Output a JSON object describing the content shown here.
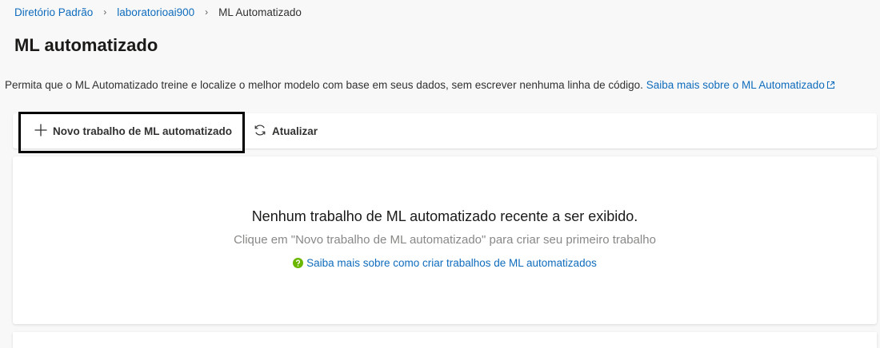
{
  "breadcrumb": {
    "items": [
      "Diretório Padrão",
      "laboratorioai900"
    ],
    "current": "ML Automatizado"
  },
  "page": {
    "title": "ML automatizado",
    "description": "Permita que o ML Automatizado treine e localize o melhor modelo com base em seus dados, sem escrever nenhuma linha de código.",
    "learn_more_link": "Saiba mais sobre o ML Automatizado"
  },
  "toolbar": {
    "new_job_label": "Novo trabalho de ML automatizado",
    "refresh_label": "Atualizar"
  },
  "empty_state": {
    "title": "Nenhum trabalho de ML automatizado recente a ser exibido.",
    "subtitle": "Clique em \"Novo trabalho de ML automatizado\" para criar seu primeiro trabalho",
    "help_link": "Saiba mais sobre como criar trabalhos de ML automatizados"
  },
  "icons": {
    "external_link": "external-link-icon",
    "add": "plus-icon",
    "refresh": "refresh-icon",
    "help": "help-circle-icon"
  },
  "colors": {
    "link": "#0f6cbd",
    "help_icon": "#6bb700",
    "highlight_border": "#000000"
  }
}
